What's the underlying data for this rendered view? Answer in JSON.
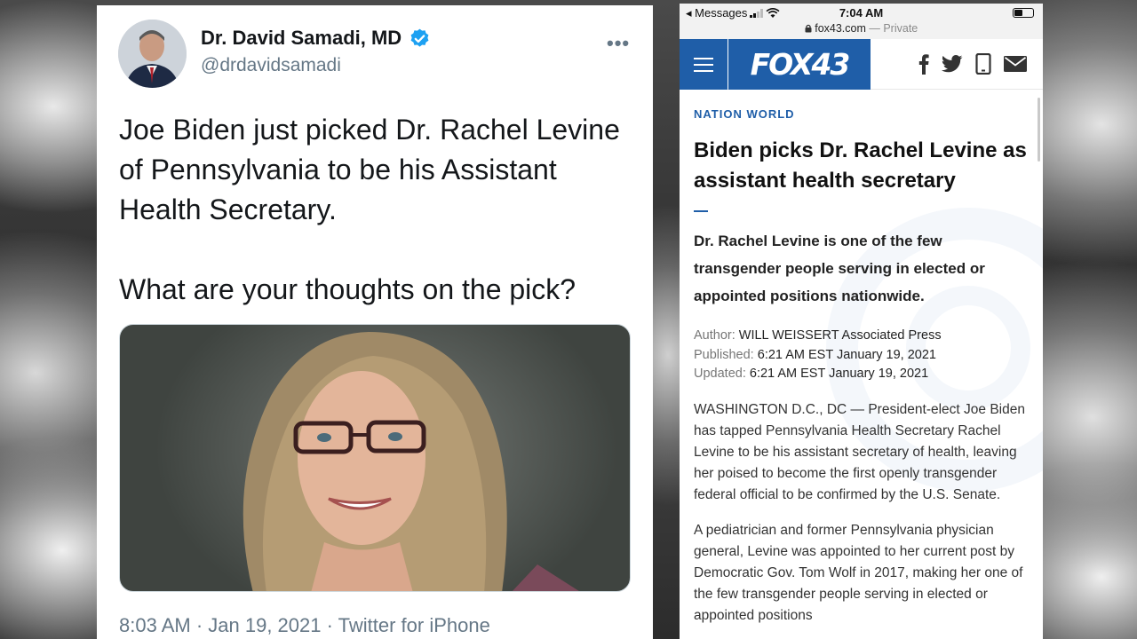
{
  "tweet": {
    "display_name": "Dr. David Samadi, MD",
    "handle": "@drdavidsamadi",
    "paragraphs": [
      "Joe Biden just picked Dr. Rachel Levine of Pennsylvania to be his Assistant Health Secretary.",
      "What are your thoughts on the pick?"
    ],
    "meta": "8:03 AM · Jan 19, 2021 · Twitter for iPhone",
    "more_icon": "more-options-icon",
    "verified_color": "#1da1f2"
  },
  "phone": {
    "status": {
      "back_app": "◂ Messages",
      "time": "7:04 AM",
      "url": "fox43.com",
      "private": "— Private"
    },
    "nav": {
      "logo_text": "FOX43",
      "brand_color": "#1f5ea8",
      "social_icons": [
        "facebook-icon",
        "twitter-icon",
        "phone-icon",
        "mail-icon"
      ]
    },
    "article": {
      "section": "NATION WORLD",
      "headline": "Biden picks Dr. Rachel Levine as assistant health secretary",
      "dek": "Dr. Rachel Levine is one of the few transgender people serving in elected or appointed positions nationwide.",
      "author_label": "Author:",
      "author": "WILL WEISSERT Associated Press",
      "published_label": "Published:",
      "published": "6:21 AM EST January 19, 2021",
      "updated_label": "Updated:",
      "updated": "6:21 AM EST January 19, 2021",
      "body": [
        "WASHINGTON D.C., DC — President-elect Joe Biden has tapped Pennsylvania Health Secretary Rachel Levine to be his assistant secretary of health, leaving her poised to become the first openly transgender federal official to be confirmed by the U.S. Senate.",
        "A pediatrician and former Pennsylvania physician general, Levine was appointed to her current post by Democratic Gov. Tom Wolf in 2017, making her one of the few transgender people serving in elected or appointed positions"
      ]
    }
  }
}
